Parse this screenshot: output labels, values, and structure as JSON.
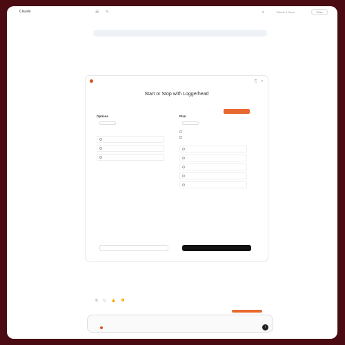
{
  "app": {
    "title": "Claude",
    "top_right": "Claude 4 Opus",
    "share_label": "Share"
  },
  "banner": {
    "text": ""
  },
  "paragraphs": [],
  "card": {
    "header": "",
    "title": "Start or Stop with Loggerhead",
    "subtitle": "",
    "badge": "",
    "col1": {
      "title": "Options",
      "desc": "",
      "select_label": "",
      "options": [
        {
          "label": ""
        },
        {
          "label": ""
        },
        {
          "label": ""
        }
      ]
    },
    "col2": {
      "title": "Plan",
      "desc": "",
      "select_label": "",
      "section_title": "",
      "checks": [
        {
          "label": ""
        },
        {
          "label": ""
        }
      ],
      "options": [
        {
          "label": ""
        },
        {
          "label": ""
        },
        {
          "label": ""
        },
        {
          "label": ""
        },
        {
          "label": ""
        }
      ],
      "skip": ""
    },
    "col3": {
      "title": ""
    },
    "btn_left": "",
    "btn_right": "",
    "footer": ""
  },
  "after_paragraphs": [],
  "reactions": [
    "⎘",
    "↻",
    "👍",
    "👎"
  ],
  "input": {
    "placeholder": "",
    "chip": "",
    "model": "",
    "disclaimer": ""
  },
  "colors": {
    "accent": "#e8692f",
    "frame": "#4a0c12",
    "button_dark": "#111111"
  }
}
